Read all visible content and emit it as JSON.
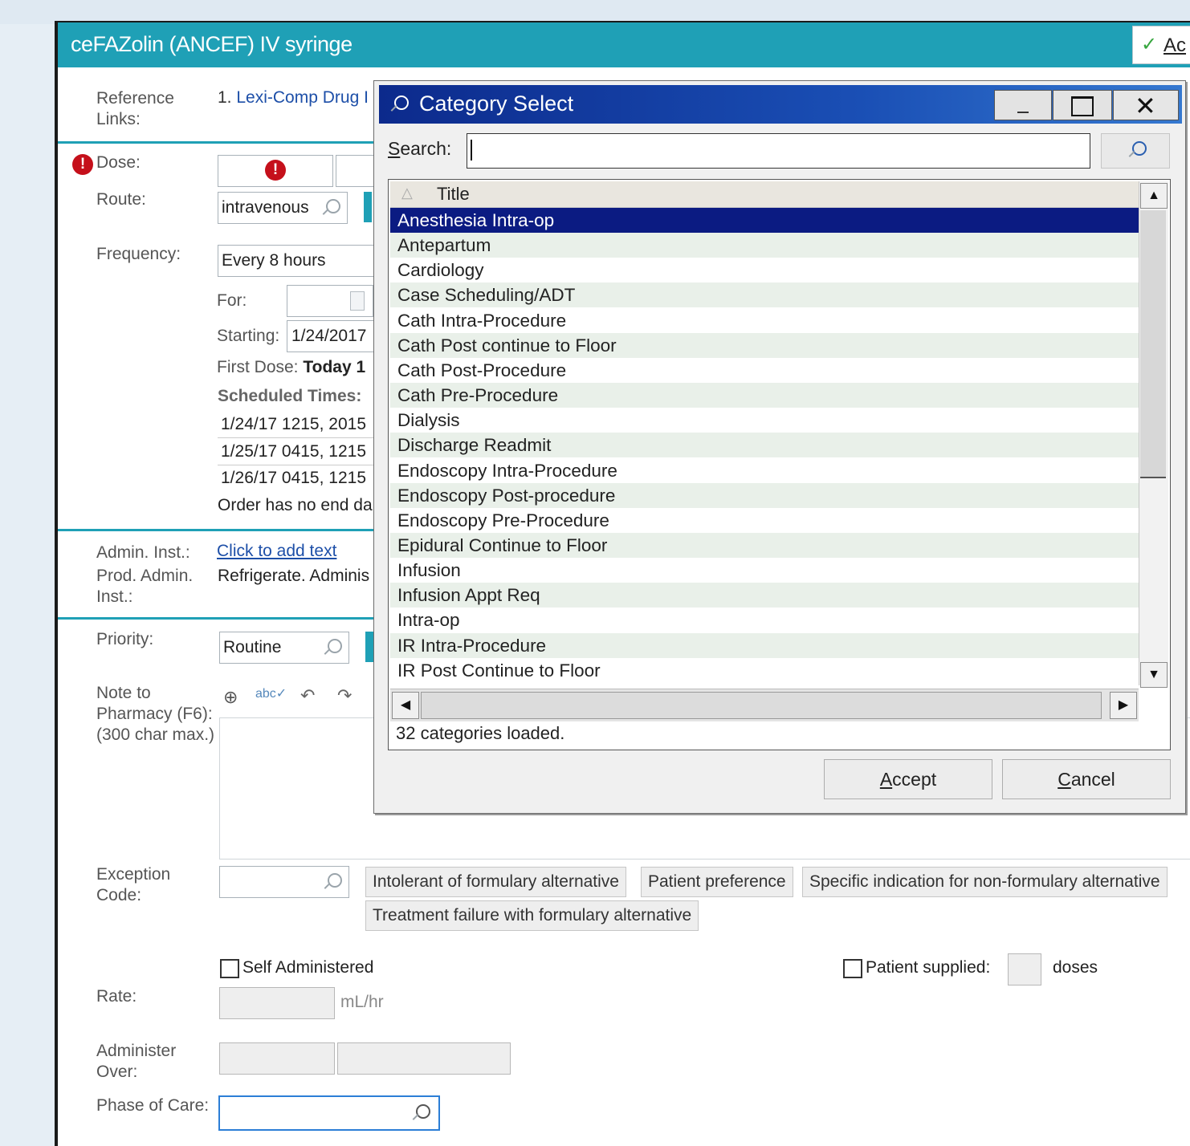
{
  "order": {
    "title": "ceFAZolin (ANCEF) IV syringe",
    "accept_label": "Ac",
    "reference_label": "Reference Links:",
    "reference_link": "1. Lexi-Comp Drug I",
    "dose_label": "Dose:",
    "route_label": "Route:",
    "route_value": "intravenous",
    "frequency_label": "Frequency:",
    "frequency_value": "Every 8 hours",
    "for_label": "For:",
    "starting_label": "Starting:",
    "starting_value": "1/24/2017",
    "first_dose_label": "First Dose:",
    "first_dose_value": "Today 1",
    "scheduled_times_label": "Scheduled Times:",
    "scheduled_times": [
      "1/24/17 1215, 2015",
      "1/25/17 0415, 1215",
      "1/26/17 0415, 1215"
    ],
    "end_note": "Order has no end da",
    "admin_inst_label": "Admin. Inst.:",
    "admin_inst_link": "Click to add text",
    "prod_admin_label": "Prod. Admin. Inst.:",
    "prod_admin_value": "Refrigerate. Adminis",
    "priority_label": "Priority:",
    "priority_value": "Routine",
    "note_label": "Note to Pharmacy (F6): (300 char max.)",
    "exception_label": "Exception Code:",
    "exception_chips": [
      "Intolerant of formulary alternative",
      "Patient preference",
      "Specific indication for non-formulary alternative",
      "Treatment failure with formulary alternative"
    ],
    "self_admin_label": "Self Administered",
    "patient_supplied_label": "Patient supplied:",
    "doses_label": "doses",
    "rate_label": "Rate:",
    "rate_unit": "mL/hr",
    "administer_over_label": "Administer Over:",
    "phase_label": "Phase of Care:"
  },
  "dialog": {
    "title": "Category Select",
    "search_label": "Search:",
    "column_title": "Title",
    "items": [
      "Anesthesia Intra-op",
      "Antepartum",
      "Cardiology",
      "Case Scheduling/ADT",
      "Cath Intra-Procedure",
      "Cath Post continue to Floor",
      "Cath Post-Procedure",
      "Cath Pre-Procedure",
      "Dialysis",
      "Discharge Readmit",
      "Endoscopy Intra-Procedure",
      "Endoscopy Post-procedure",
      "Endoscopy Pre-Procedure",
      "Epidural Continue to Floor",
      "Infusion",
      "Infusion Appt Req",
      "Intra-op",
      "IR Intra-Procedure",
      "IR Post Continue to Floor"
    ],
    "selected_index": 0,
    "status": "32 categories loaded.",
    "accept_label": "Accept",
    "cancel_label": "Cancel"
  }
}
